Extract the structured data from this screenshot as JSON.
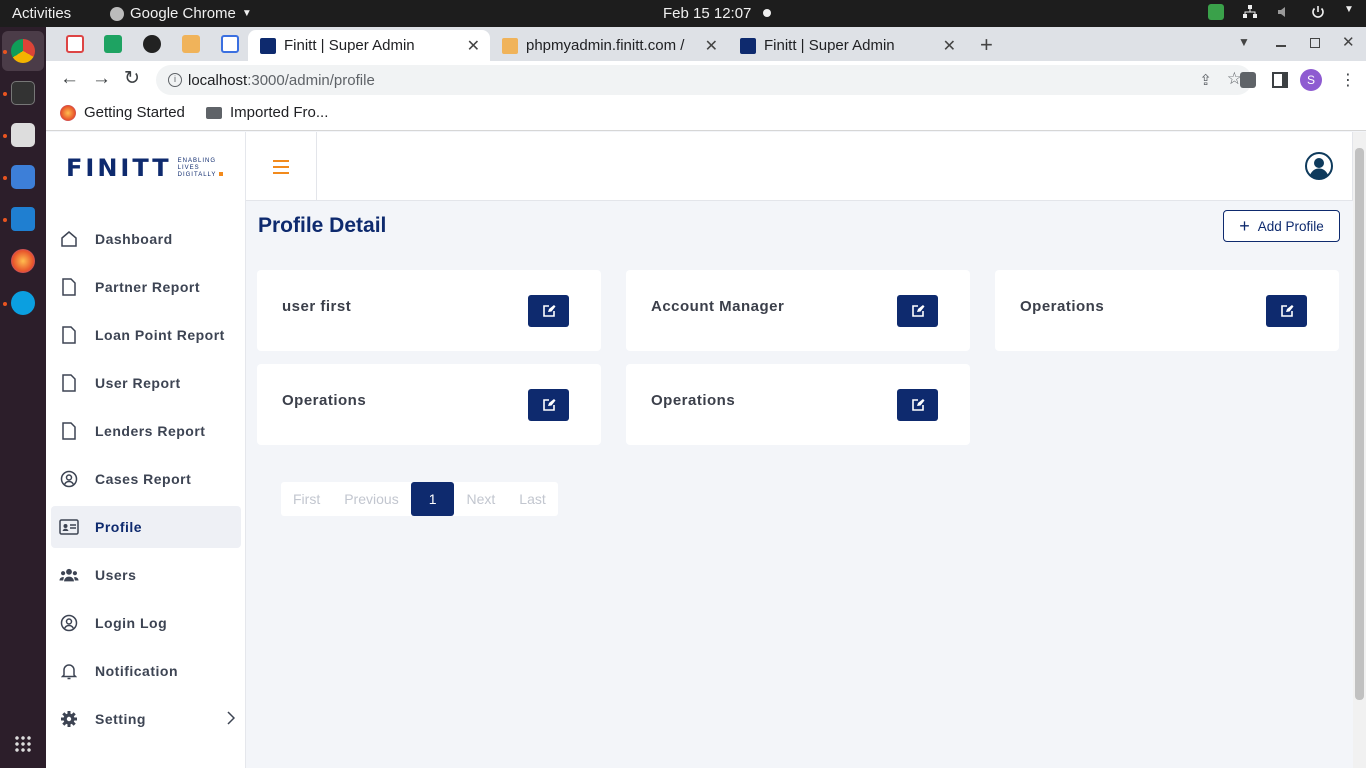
{
  "os": {
    "activities": "Activities",
    "app_name": "Google Chrome",
    "clock": "Feb 15  12:07"
  },
  "browser": {
    "tabs": [
      {
        "label": "Finitt | Super Admin",
        "active": true
      },
      {
        "label": "phpmyadmin.finitt.com /",
        "active": false
      },
      {
        "label": "Finitt | Super Admin",
        "active": false
      }
    ],
    "url_host": "localhost",
    "url_path": ":3000/admin/profile",
    "profile_initial": "S",
    "bookmarks": [
      "Getting Started",
      "Imported Fro..."
    ]
  },
  "app": {
    "logo": {
      "wordmark": "FINITT",
      "tagline": [
        "ENABLING",
        "LIVES",
        "DIGITALLY"
      ]
    },
    "nav": [
      {
        "label": "Dashboard",
        "icon": "home-icon"
      },
      {
        "label": "Partner Report",
        "icon": "document-icon"
      },
      {
        "label": "Loan Point Report",
        "icon": "document-icon"
      },
      {
        "label": "User Report",
        "icon": "document-icon"
      },
      {
        "label": "Lenders Report",
        "icon": "document-icon"
      },
      {
        "label": "Cases Report",
        "icon": "user-circle-icon"
      },
      {
        "label": "Profile",
        "icon": "id-card-icon",
        "active": true
      },
      {
        "label": "Users",
        "icon": "users-icon"
      },
      {
        "label": "Login Log",
        "icon": "user-circle-icon"
      },
      {
        "label": "Notification",
        "icon": "bell-icon"
      },
      {
        "label": "Setting",
        "icon": "gear-icon"
      }
    ],
    "page_title": "Profile Detail",
    "add_button": "Add Profile",
    "profiles": [
      "user first",
      "Account Manager",
      "Operations",
      "Operations",
      "Operations"
    ],
    "pagination": {
      "first": "First",
      "previous": "Previous",
      "current": "1",
      "next": "Next",
      "last": "Last"
    },
    "colors": {
      "primary": "#0e2a6e",
      "accent": "#f28a1c"
    }
  }
}
